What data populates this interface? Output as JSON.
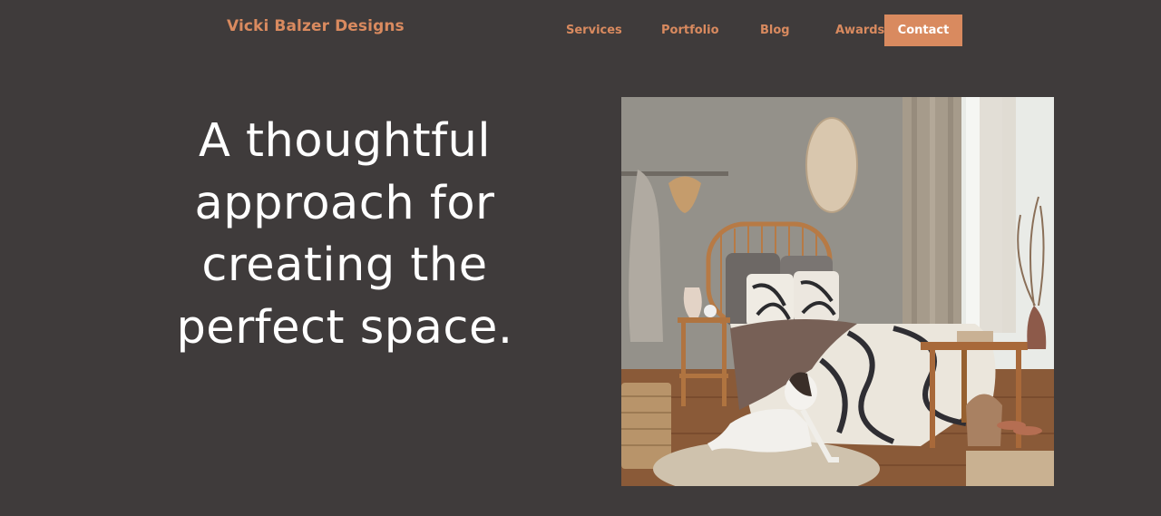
{
  "header": {
    "brand": "Vicki Balzer Designs",
    "nav": {
      "services": "Services",
      "portfolio": "Portfolio",
      "blog": "Blog",
      "awards": "Awards",
      "contact": "Contact"
    }
  },
  "hero": {
    "headline_lines": [
      "A thoughtful",
      "approach for",
      "creating the",
      "perfect space."
    ]
  },
  "colors": {
    "background": "#3f3b3b",
    "accent": "#d98a5f",
    "text": "#ffffff"
  }
}
